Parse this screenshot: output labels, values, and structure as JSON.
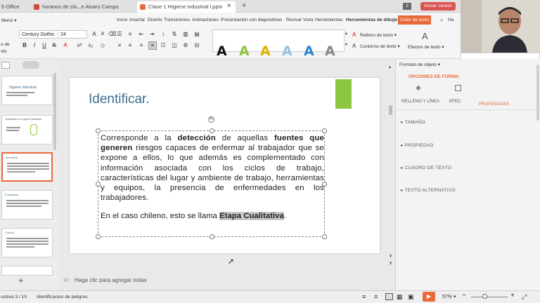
{
  "tabs": {
    "office": "5 Office",
    "tab2": "horanos de cla...e Alvaro Campos",
    "tab3": "Clase 1 HIgiene industrial l.pptx",
    "tab_count": "2",
    "signin": "Iniciar sesión"
  },
  "ribbon": {
    "menu": "Menú",
    "tabs": [
      "Inicio",
      "Insertar",
      "Diseño",
      "Transiciones",
      "Animaciones",
      "Presentación con diapositivas",
      "Revisar",
      "Vista",
      "Herramientas",
      "Herramientas de dibujo"
    ],
    "color_tab": "Color de texto",
    "search_short": "Ha",
    "font_name": "Century Gothic",
    "font_size": "24",
    "left_labels": [
      "o de",
      "xto"
    ],
    "wordart_glyph": "A",
    "fill_text": "Relleno de texto",
    "outline_text": "Contorno de texto",
    "effects_text": "Efectos de texto"
  },
  "slide": {
    "title": "Identificar.",
    "p1_a": "Corresponde a la ",
    "p1_b": "detección",
    "p1_c": " de aquellas ",
    "p1_d": "fuentes que generen",
    "p1_e": " riesgos capaces de enfermar al trabajador que se expone a ellos, lo que además es complementado con información asociada con los ciclos de trabajo, características del lugar y ambiente de trabajo, herramientas y equipos, la presencia de enfermedades en los trabajadores.",
    "p2_a": "En el caso chileno, esto se llama ",
    "p2_b": "Etapa Cualitativa",
    "p2_c": "."
  },
  "notes": "Haga clic para agregar notas",
  "status": {
    "slide_info": "ositiva  3 / 10",
    "slide_name": "Identificacion de peligros",
    "zoom": "57%"
  },
  "panel": {
    "title": "Formato de objeto",
    "options_tab": "OPCIONES DE FORMA",
    "fill_line": "RELLENO Y LÍNEA",
    "effects": "EFEC",
    "props": "PROPIEDADES",
    "sections": [
      "TAMAÑO",
      "PROPIEDAD",
      "CUADRO DE TEXTO",
      "TEXTO ALTERNATIVO"
    ]
  },
  "thumbs": [
    {
      "title": "Higiene Industrial."
    },
    {
      "title": "Orientación a la higiene industrial"
    },
    {
      "title": "Identificar."
    },
    {
      "title": "Evaluación"
    },
    {
      "title": "Control"
    }
  ],
  "colors": {
    "accent": "#e86a3a",
    "green": "#8dc63f",
    "title_blue": "#3f6f8f"
  },
  "wordart_colors": [
    "#111111",
    "#8dc63f",
    "#e0b000",
    "#8fc3e6",
    "#2f85d0",
    "#888888"
  ]
}
